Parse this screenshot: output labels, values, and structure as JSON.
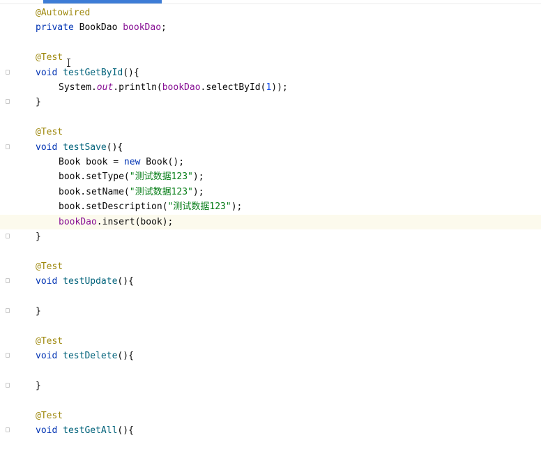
{
  "editor": {
    "code_lines": [
      {
        "tokens": [
          {
            "t": "@Autowired",
            "c": "ann"
          }
        ]
      },
      {
        "tokens": [
          {
            "t": "private ",
            "c": "kw"
          },
          {
            "t": "BookDao ",
            "c": ""
          },
          {
            "t": "bookDao",
            "c": "field"
          },
          {
            "t": ";",
            "c": ""
          }
        ]
      },
      {
        "tokens": []
      },
      {
        "tokens": [
          {
            "t": "@Test",
            "c": "ann"
          }
        ]
      },
      {
        "tokens": [
          {
            "t": "void ",
            "c": "kw"
          },
          {
            "t": "testGetById",
            "c": "fn"
          },
          {
            "t": "(){",
            "c": ""
          }
        ]
      },
      {
        "indent": true,
        "tokens": [
          {
            "t": "System.",
            "c": ""
          },
          {
            "t": "out",
            "c": "static"
          },
          {
            "t": ".println(",
            "c": ""
          },
          {
            "t": "bookDao",
            "c": "field"
          },
          {
            "t": ".selectById(",
            "c": ""
          },
          {
            "t": "1",
            "c": "num"
          },
          {
            "t": "));",
            "c": ""
          }
        ]
      },
      {
        "tokens": [
          {
            "t": "}",
            "c": ""
          }
        ]
      },
      {
        "tokens": []
      },
      {
        "tokens": [
          {
            "t": "@Test",
            "c": "ann"
          }
        ]
      },
      {
        "tokens": [
          {
            "t": "void ",
            "c": "kw"
          },
          {
            "t": "testSave",
            "c": "fn"
          },
          {
            "t": "(){",
            "c": ""
          }
        ]
      },
      {
        "indent": true,
        "tokens": [
          {
            "t": "Book book = ",
            "c": ""
          },
          {
            "t": "new ",
            "c": "kw"
          },
          {
            "t": "Book();",
            "c": ""
          }
        ]
      },
      {
        "indent": true,
        "tokens": [
          {
            "t": "book.setType(",
            "c": ""
          },
          {
            "t": "\"测试数据123\"",
            "c": "str"
          },
          {
            "t": ");",
            "c": ""
          }
        ]
      },
      {
        "indent": true,
        "tokens": [
          {
            "t": "book.setName(",
            "c": ""
          },
          {
            "t": "\"测试数据123\"",
            "c": "str"
          },
          {
            "t": ");",
            "c": ""
          }
        ]
      },
      {
        "indent": true,
        "tokens": [
          {
            "t": "book.setDescription(",
            "c": ""
          },
          {
            "t": "\"测试数据123\"",
            "c": "str"
          },
          {
            "t": ");",
            "c": ""
          }
        ]
      },
      {
        "indent": true,
        "current": true,
        "tokens": [
          {
            "t": "bookDao",
            "c": "field"
          },
          {
            "t": ".insert(book);",
            "c": ""
          }
        ]
      },
      {
        "tokens": [
          {
            "t": "}",
            "c": ""
          }
        ]
      },
      {
        "tokens": []
      },
      {
        "tokens": [
          {
            "t": "@Test",
            "c": "ann"
          }
        ]
      },
      {
        "tokens": [
          {
            "t": "void ",
            "c": "kw"
          },
          {
            "t": "testUpdate",
            "c": "fn"
          },
          {
            "t": "(){",
            "c": ""
          }
        ]
      },
      {
        "tokens": []
      },
      {
        "tokens": [
          {
            "t": "}",
            "c": ""
          }
        ]
      },
      {
        "tokens": []
      },
      {
        "tokens": [
          {
            "t": "@Test",
            "c": "ann"
          }
        ]
      },
      {
        "tokens": [
          {
            "t": "void ",
            "c": "kw"
          },
          {
            "t": "testDelete",
            "c": "fn"
          },
          {
            "t": "(){",
            "c": ""
          }
        ]
      },
      {
        "tokens": []
      },
      {
        "tokens": [
          {
            "t": "}",
            "c": ""
          }
        ]
      },
      {
        "tokens": []
      },
      {
        "tokens": [
          {
            "t": "@Test",
            "c": "ann"
          }
        ]
      },
      {
        "tokens": [
          {
            "t": "void ",
            "c": "kw"
          },
          {
            "t": "testGetAll",
            "c": "fn"
          },
          {
            "t": "(){",
            "c": ""
          }
        ]
      }
    ],
    "colors": {
      "keyword": "#0033b3",
      "annotation": "#9e880d",
      "method": "#00627a",
      "field": "#871094",
      "string": "#067d17",
      "number": "#1750eb",
      "current_line": "#fcfaed",
      "active_tab": "#3d7cd6"
    }
  }
}
